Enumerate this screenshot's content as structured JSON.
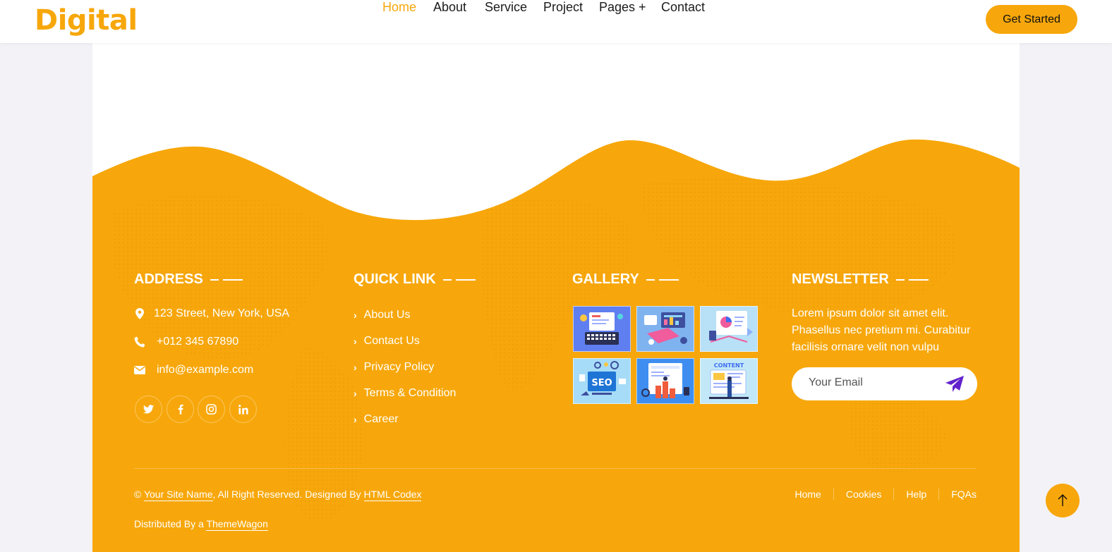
{
  "brand": "Digital",
  "nav": {
    "items": [
      "Home",
      "About",
      "Service",
      "Project",
      "Pages +",
      "Contact"
    ],
    "active": "Home",
    "cta": "Get Started"
  },
  "footer": {
    "address": {
      "title": "ADDRESS",
      "street": "123 Street, New York, USA",
      "phone": "+012 345 67890",
      "email": "info@example.com",
      "socials": [
        "twitter-icon",
        "facebook-icon",
        "instagram-icon",
        "linkedin-icon"
      ]
    },
    "quick_link": {
      "title": "QUICK LINK",
      "items": [
        "About Us",
        "Contact Us",
        "Privacy Policy",
        "Terms & Condition",
        "Career"
      ]
    },
    "gallery": {
      "title": "GALLERY",
      "labels": [
        "SEO",
        "CONTENT"
      ]
    },
    "newsletter": {
      "title": "NEWSLETTER",
      "text": "Lorem ipsum dolor sit amet elit. Phasellus nec pretium mi. Curabitur facilisis ornare velit non vulpu",
      "placeholder": "Your Email"
    },
    "copyright": {
      "prefix": "©",
      "site": "Your Site Name",
      "middle": ", All Right Reserved. Designed By",
      "designer": "HTML Codex",
      "distributed": "Distributed By a",
      "distributor": "ThemeWagon"
    },
    "menu": [
      "Home",
      "Cookies",
      "Help",
      "FQAs"
    ]
  },
  "colors": {
    "accent": "#f7a70b",
    "send_icon": "#6222cc"
  }
}
